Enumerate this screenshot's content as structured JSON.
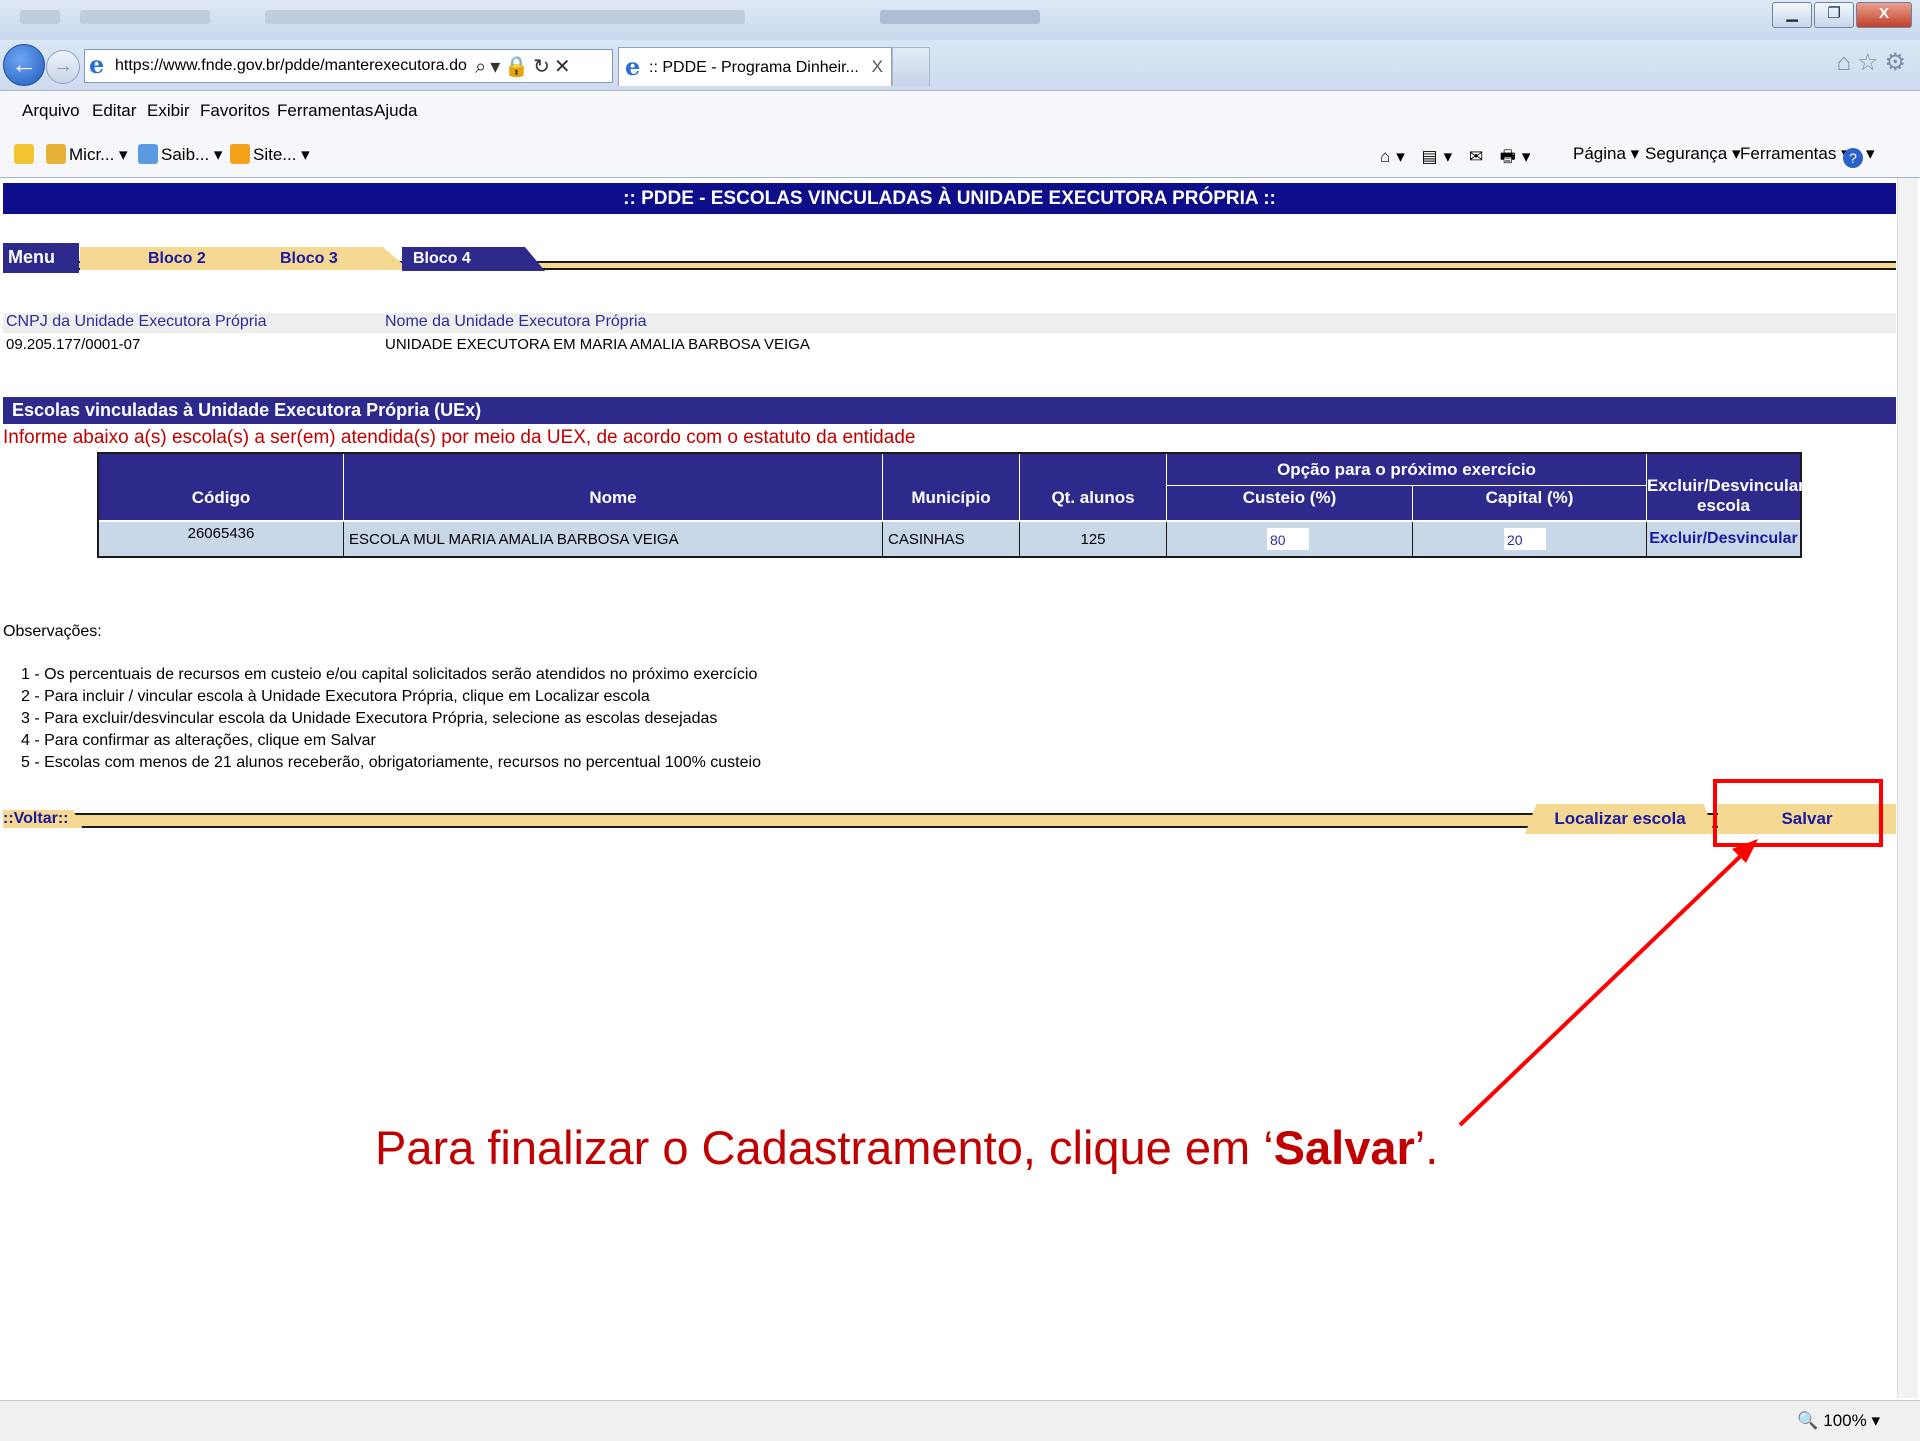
{
  "browser": {
    "url": "https://www.fnde.gov.br/pdde/manterexecutora.do",
    "tab_title": ":: PDDE - Programa Dinheir...",
    "tab_close": "X",
    "menu": [
      "Arquivo",
      "Editar",
      "Exibir",
      "Favoritos",
      "Ferramentas",
      "Ajuda"
    ],
    "favorites": [
      "Micr... ▾",
      "Saib... ▾",
      "Site... ▾"
    ],
    "commands": [
      "Página ▾",
      "Segurança ▾",
      "Ferramentas ▾"
    ],
    "zoom": "100%"
  },
  "page": {
    "header": ":: PDDE - ESCOLAS VINCULADAS À UNIDADE EXECUTORA PRÓPRIA ::",
    "tabs": [
      "Menu",
      "Bloco 2",
      "Bloco 3",
      "Bloco 4"
    ],
    "cnpj_label": "CNPJ da Unidade Executora Própria",
    "cnpj_value": "09.205.177/0001-07",
    "nome_label": "Nome da Unidade Executora Própria",
    "nome_value": "UNIDADE EXECUTORA EM MARIA AMALIA BARBOSA VEIGA",
    "section_title": "Escolas vinculadas à Unidade Executora Própria (UEx)",
    "inform": "Informe abaixo a(s) escola(s) a ser(em) atendida(s) por meio da UEX, de acordo com o estatuto da entidade",
    "table": {
      "group_header": "Opção para o próximo exercício",
      "headers": [
        "Código",
        "Nome",
        "Município",
        "Qt. alunos",
        "Custeio (%)",
        "Capital (%)",
        "Excluir/Desvincular escola"
      ],
      "row": {
        "codigo": "26065436",
        "nome": "ESCOLA MUL MARIA AMALIA BARBOSA VEIGA",
        "municipio": "CASINHAS",
        "qt_alunos": "125",
        "custeio": "80",
        "capital": "20",
        "action": "Excluir/Desvincular"
      }
    },
    "observacoes_title": "Observações:",
    "observacoes": [
      "1 - Os percentuais de recursos em custeio e/ou capital solicitados serão atendidos no próximo exercício",
      "2 - Para incluir / vincular escola à Unidade Executora Própria, clique em Localizar escola",
      "3 - Para excluir/desvincular escola da Unidade Executora Própria, selecione as escolas desejadas",
      "4 - Para confirmar as alterações, clique em Salvar",
      "5 - Escolas com menos de 21 alunos receberão, obrigatoriamente, recursos no percentual 100% custeio"
    ],
    "voltar": "::Voltar::",
    "localizar": "Localizar escola",
    "salvar": "Salvar"
  },
  "annotation": {
    "text_before": "Para finalizar o Cadastramento, clique em ‘",
    "text_bold": "Salvar",
    "text_after": "’.",
    "color": "#ff0000"
  },
  "colors": {
    "navy": "#0e0e8a",
    "tab_yellow": "#f5d891",
    "header_purple": "#2d2a8c",
    "row_blue": "#c9d8e8",
    "alert_red": "#c00000"
  }
}
